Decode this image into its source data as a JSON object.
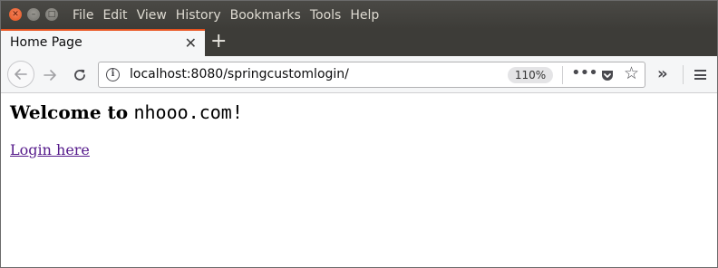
{
  "menu": {
    "items": [
      "File",
      "Edit",
      "View",
      "History",
      "Bookmarks",
      "Tools",
      "Help"
    ]
  },
  "tab": {
    "title": "Home Page",
    "close_glyph": "✕",
    "new_tab_glyph": "+"
  },
  "urlbar": {
    "url": "localhost:8080/springcustomlogin/",
    "zoom": "110%",
    "info_glyph": "i"
  },
  "page": {
    "heading_bold": "Welcome to",
    "heading_mono": "nhooo.com",
    "heading_suffix": "!",
    "link_text": "Login here"
  },
  "colors": {
    "accent_tab": "#e95420",
    "link_visited": "#551a8b",
    "titlebar": "#3d3c38"
  },
  "icons": [
    "close-window-icon",
    "minimize-window-icon",
    "maximize-window-icon",
    "back-arrow-icon",
    "forward-arrow-icon",
    "reload-icon",
    "info-icon",
    "more-actions-icon",
    "pocket-icon",
    "bookmark-star-icon",
    "overflow-chevron-icon",
    "hamburger-menu-icon"
  ]
}
